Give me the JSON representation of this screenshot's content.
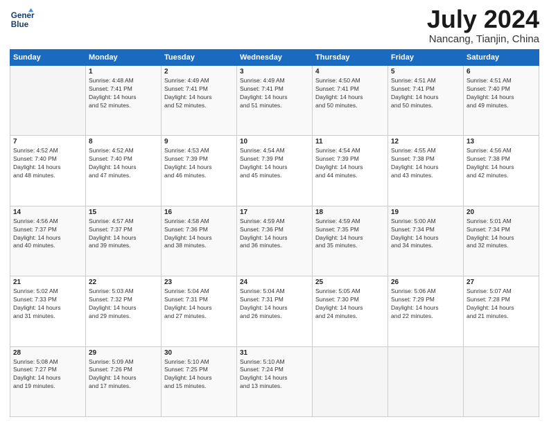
{
  "header": {
    "logo_line1": "General",
    "logo_line2": "Blue",
    "month": "July 2024",
    "location": "Nancang, Tianjin, China"
  },
  "days_of_week": [
    "Sunday",
    "Monday",
    "Tuesday",
    "Wednesday",
    "Thursday",
    "Friday",
    "Saturday"
  ],
  "weeks": [
    [
      {
        "day": "",
        "content": ""
      },
      {
        "day": "1",
        "content": "Sunrise: 4:48 AM\nSunset: 7:41 PM\nDaylight: 14 hours\nand 52 minutes."
      },
      {
        "day": "2",
        "content": "Sunrise: 4:49 AM\nSunset: 7:41 PM\nDaylight: 14 hours\nand 52 minutes."
      },
      {
        "day": "3",
        "content": "Sunrise: 4:49 AM\nSunset: 7:41 PM\nDaylight: 14 hours\nand 51 minutes."
      },
      {
        "day": "4",
        "content": "Sunrise: 4:50 AM\nSunset: 7:41 PM\nDaylight: 14 hours\nand 50 minutes."
      },
      {
        "day": "5",
        "content": "Sunrise: 4:51 AM\nSunset: 7:41 PM\nDaylight: 14 hours\nand 50 minutes."
      },
      {
        "day": "6",
        "content": "Sunrise: 4:51 AM\nSunset: 7:40 PM\nDaylight: 14 hours\nand 49 minutes."
      }
    ],
    [
      {
        "day": "7",
        "content": "Sunrise: 4:52 AM\nSunset: 7:40 PM\nDaylight: 14 hours\nand 48 minutes."
      },
      {
        "day": "8",
        "content": "Sunrise: 4:52 AM\nSunset: 7:40 PM\nDaylight: 14 hours\nand 47 minutes."
      },
      {
        "day": "9",
        "content": "Sunrise: 4:53 AM\nSunset: 7:39 PM\nDaylight: 14 hours\nand 46 minutes."
      },
      {
        "day": "10",
        "content": "Sunrise: 4:54 AM\nSunset: 7:39 PM\nDaylight: 14 hours\nand 45 minutes."
      },
      {
        "day": "11",
        "content": "Sunrise: 4:54 AM\nSunset: 7:39 PM\nDaylight: 14 hours\nand 44 minutes."
      },
      {
        "day": "12",
        "content": "Sunrise: 4:55 AM\nSunset: 7:38 PM\nDaylight: 14 hours\nand 43 minutes."
      },
      {
        "day": "13",
        "content": "Sunrise: 4:56 AM\nSunset: 7:38 PM\nDaylight: 14 hours\nand 42 minutes."
      }
    ],
    [
      {
        "day": "14",
        "content": "Sunrise: 4:56 AM\nSunset: 7:37 PM\nDaylight: 14 hours\nand 40 minutes."
      },
      {
        "day": "15",
        "content": "Sunrise: 4:57 AM\nSunset: 7:37 PM\nDaylight: 14 hours\nand 39 minutes."
      },
      {
        "day": "16",
        "content": "Sunrise: 4:58 AM\nSunset: 7:36 PM\nDaylight: 14 hours\nand 38 minutes."
      },
      {
        "day": "17",
        "content": "Sunrise: 4:59 AM\nSunset: 7:36 PM\nDaylight: 14 hours\nand 36 minutes."
      },
      {
        "day": "18",
        "content": "Sunrise: 4:59 AM\nSunset: 7:35 PM\nDaylight: 14 hours\nand 35 minutes."
      },
      {
        "day": "19",
        "content": "Sunrise: 5:00 AM\nSunset: 7:34 PM\nDaylight: 14 hours\nand 34 minutes."
      },
      {
        "day": "20",
        "content": "Sunrise: 5:01 AM\nSunset: 7:34 PM\nDaylight: 14 hours\nand 32 minutes."
      }
    ],
    [
      {
        "day": "21",
        "content": "Sunrise: 5:02 AM\nSunset: 7:33 PM\nDaylight: 14 hours\nand 31 minutes."
      },
      {
        "day": "22",
        "content": "Sunrise: 5:03 AM\nSunset: 7:32 PM\nDaylight: 14 hours\nand 29 minutes."
      },
      {
        "day": "23",
        "content": "Sunrise: 5:04 AM\nSunset: 7:31 PM\nDaylight: 14 hours\nand 27 minutes."
      },
      {
        "day": "24",
        "content": "Sunrise: 5:04 AM\nSunset: 7:31 PM\nDaylight: 14 hours\nand 26 minutes."
      },
      {
        "day": "25",
        "content": "Sunrise: 5:05 AM\nSunset: 7:30 PM\nDaylight: 14 hours\nand 24 minutes."
      },
      {
        "day": "26",
        "content": "Sunrise: 5:06 AM\nSunset: 7:29 PM\nDaylight: 14 hours\nand 22 minutes."
      },
      {
        "day": "27",
        "content": "Sunrise: 5:07 AM\nSunset: 7:28 PM\nDaylight: 14 hours\nand 21 minutes."
      }
    ],
    [
      {
        "day": "28",
        "content": "Sunrise: 5:08 AM\nSunset: 7:27 PM\nDaylight: 14 hours\nand 19 minutes."
      },
      {
        "day": "29",
        "content": "Sunrise: 5:09 AM\nSunset: 7:26 PM\nDaylight: 14 hours\nand 17 minutes."
      },
      {
        "day": "30",
        "content": "Sunrise: 5:10 AM\nSunset: 7:25 PM\nDaylight: 14 hours\nand 15 minutes."
      },
      {
        "day": "31",
        "content": "Sunrise: 5:10 AM\nSunset: 7:24 PM\nDaylight: 14 hours\nand 13 minutes."
      },
      {
        "day": "",
        "content": ""
      },
      {
        "day": "",
        "content": ""
      },
      {
        "day": "",
        "content": ""
      }
    ]
  ]
}
